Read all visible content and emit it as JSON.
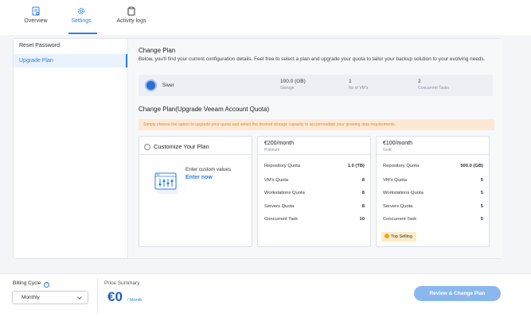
{
  "tabs": [
    {
      "label": "Overview",
      "icon": "report-icon"
    },
    {
      "label": "Settings",
      "icon": "gear-icon"
    },
    {
      "label": "Activity logs",
      "icon": "clipboard-icon"
    }
  ],
  "sidebar": {
    "items": [
      {
        "label": "Reset Password"
      },
      {
        "label": "Upgrade Plan"
      }
    ]
  },
  "change_plan": {
    "title": "Change Plan",
    "description": "Below, you'll find your current configuration details. Feel free to select a plan and upgrade your quota to tailor your backup solution to your evolving needs.",
    "current": {
      "name": "Siver",
      "storage_value": "100.0 (GB)",
      "storage_label": "Storage",
      "vms_value": "1",
      "vms_label": "No of VM's",
      "tasks_value": "2",
      "tasks_label": "Concurrent Tasks"
    },
    "subtitle": "Change Plan(Upgrade Veeam Account Quota)",
    "notice": "Simply choose the option to upgrade your quota and select the desired storage capacity to accommodate your growing data requirements."
  },
  "custom_plan": {
    "title": "Customize Your Plan",
    "text": "Enter custom values",
    "link": "Enter now"
  },
  "plans": [
    {
      "price": "€200/month",
      "tier": "Platinum",
      "quotas": [
        {
          "label": "Repository Quota",
          "value": "1.0 (TB)"
        },
        {
          "label": "VM's Quota",
          "value": "8"
        },
        {
          "label": "Workstations Quota",
          "value": "8"
        },
        {
          "label": "Servers Quota",
          "value": "8"
        },
        {
          "label": "Concurrent Task",
          "value": "10"
        }
      ]
    },
    {
      "price": "€100/month",
      "tier": "Gold",
      "quotas": [
        {
          "label": "Repository Quota",
          "value": "500.0 (GB)"
        },
        {
          "label": "VM's Quota",
          "value": "5"
        },
        {
          "label": "Workstations Quota",
          "value": "5"
        },
        {
          "label": "Servers Quota",
          "value": "5"
        },
        {
          "label": "Concurrent Task",
          "value": "5"
        }
      ],
      "badge": "Top Selling"
    }
  ],
  "footer": {
    "billing_label": "Billing Cycle",
    "billing_value": "Monthly",
    "summary_label": "Price Summary",
    "amount": "€0",
    "per": "/ Month",
    "cta": "Review & Change Plan"
  },
  "colors": {
    "accent": "#2b7de9",
    "notice_bg": "#fde9d3",
    "badge_bg": "#fdebc8",
    "cta_bg": "#8ab8ee"
  }
}
